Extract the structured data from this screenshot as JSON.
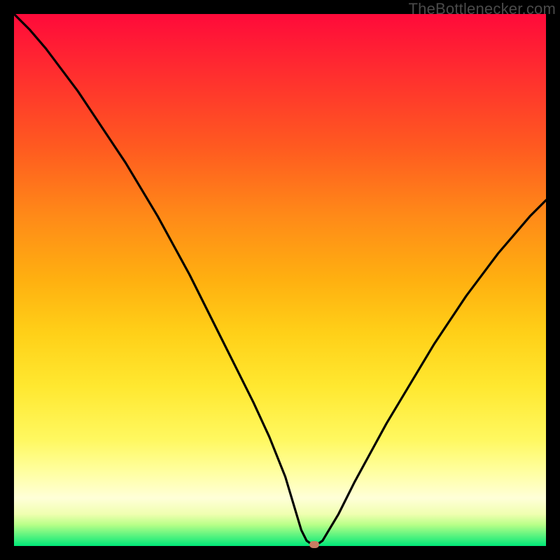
{
  "attribution": "TheBottlenecker.com",
  "chart_data": {
    "type": "line",
    "title": "",
    "xlabel": "",
    "ylabel": "",
    "xlim": [
      0,
      100
    ],
    "ylim": [
      0,
      100
    ],
    "x": [
      0,
      3,
      6,
      9,
      12,
      15,
      18,
      21,
      24,
      27,
      30,
      33,
      36,
      39,
      42,
      45,
      48,
      51,
      52.5,
      54,
      55,
      56,
      57,
      58,
      61,
      64,
      67,
      70,
      73,
      76,
      79,
      82,
      85,
      88,
      91,
      94,
      97,
      100
    ],
    "values": [
      100,
      97,
      93.5,
      89.5,
      85.5,
      81,
      76.5,
      72,
      67,
      62,
      56.5,
      51,
      45,
      39,
      33,
      27,
      20.5,
      13,
      8,
      3,
      1,
      0.3,
      0.3,
      1,
      6,
      12,
      17.5,
      23,
      28,
      33,
      38,
      42.5,
      47,
      51,
      55,
      58.5,
      62,
      65
    ],
    "minimum_marker": {
      "x": 56.5,
      "y": 0.3,
      "color": "#c97d63"
    },
    "gradient_stops": [
      {
        "pos": 0.0,
        "color": "#ff0a3a"
      },
      {
        "pos": 0.25,
        "color": "#ff5a20"
      },
      {
        "pos": 0.5,
        "color": "#ffb010"
      },
      {
        "pos": 0.7,
        "color": "#ffe830"
      },
      {
        "pos": 0.91,
        "color": "#ffffd8"
      },
      {
        "pos": 1.0,
        "color": "#00e878"
      }
    ]
  }
}
